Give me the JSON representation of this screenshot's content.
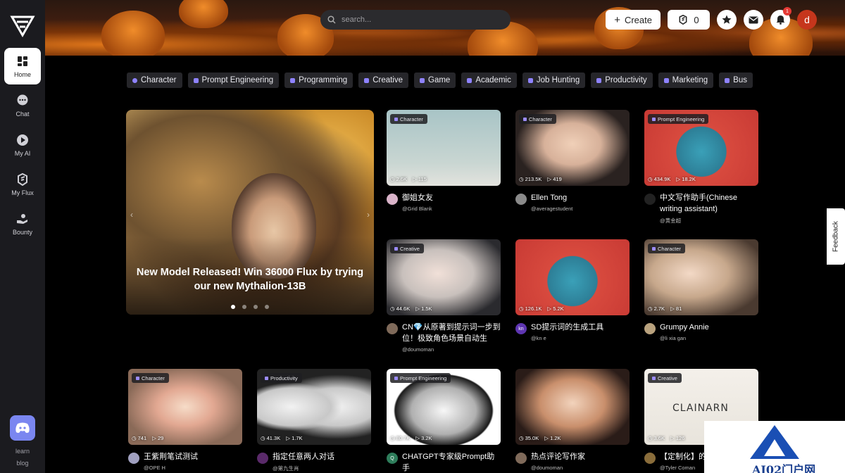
{
  "sidebar": {
    "items": [
      {
        "label": "Home",
        "icon": "grid-icon",
        "active": true
      },
      {
        "label": "Chat",
        "icon": "chat-bubble-icon"
      },
      {
        "label": "My AI",
        "icon": "play-circle-icon"
      },
      {
        "label": "My Flux",
        "icon": "flux-logo-icon"
      },
      {
        "label": "Bounty",
        "icon": "hand-coins-icon"
      }
    ],
    "learn_label": "learn",
    "blog_label": "blog"
  },
  "header": {
    "search_placeholder": "search...",
    "create_label": "Create",
    "flux_count": "0",
    "notification_count": "1",
    "avatar_letter": "d"
  },
  "categories": [
    "Character",
    "Prompt Engineering",
    "Programming",
    "Creative",
    "Game",
    "Academic",
    "Job Hunting",
    "Productivity",
    "Marketing",
    "Bus"
  ],
  "hero": {
    "title": "New Model Released! Win 36000 Flux by trying our new Mythalion-13B"
  },
  "cards": [
    {
      "tag": "Character",
      "views": "2.6K",
      "plays": "115",
      "title": "御姐女友",
      "author": "@Grid Blank",
      "avatar_color": "#d9b3c9",
      "avatar_text": ""
    },
    {
      "tag": "Character",
      "views": "213.5K",
      "plays": "419",
      "title": "Ellen Tong",
      "author": "@averagestudent",
      "avatar_color": "#8a8a8a",
      "avatar_text": ""
    },
    {
      "tag": "Prompt Engineering",
      "views": "434.9K",
      "plays": "18.2K",
      "title": "中文写作助手(Chinese writing assistant)",
      "author": "@黄金超",
      "avatar_color": "#222",
      "avatar_text": ""
    },
    {
      "tag": "Creative",
      "views": "44.6K",
      "plays": "1.5K",
      "title": "CN💎从原著到提示词一步到位！极致角色场景自动生成...",
      "author": "@doumoman",
      "avatar_color": "#7f6a5a",
      "avatar_text": ""
    },
    {
      "tag": "",
      "views": "126.1K",
      "plays": "5.2K",
      "title": "SD提示词的生成工具",
      "author": "@kn e",
      "avatar_color": "#5e35b1",
      "avatar_text": "kn"
    },
    {
      "tag": "Character",
      "views": "2.7K",
      "plays": "81",
      "title": "Grumpy Annie",
      "author": "@li xia gan",
      "avatar_color": "#b9a27e",
      "avatar_text": ""
    },
    {
      "tag": "Character",
      "views": "741",
      "plays": "29",
      "title": "王紫荆笔试测试",
      "author": "@OPE H",
      "avatar_color": "#a0a0c0",
      "avatar_text": ""
    },
    {
      "tag": "Productivity",
      "views": "41.3K",
      "plays": "1.7K",
      "title": "指定任意两人对话",
      "author": "@第九生肖",
      "avatar_color": "#5a2a6a",
      "avatar_text": ""
    },
    {
      "tag": "Prompt Engineering",
      "views": "80.7K",
      "plays": "3.2K",
      "title": "CHATGPT专家级Prompt助手",
      "author": "@9tigers2bull",
      "avatar_color": "#2e7d5b",
      "avatar_text": "Q"
    },
    {
      "tag": "",
      "views": "35.0K",
      "plays": "1.2K",
      "title": "热点评论写作家",
      "author": "@doumoman",
      "avatar_color": "#7f6a5a",
      "avatar_text": ""
    },
    {
      "tag": "Creative",
      "views": "3.6K",
      "plays": "126",
      "title": "【定制化】的",
      "author": "@Tyler Coman",
      "avatar_color": "#8a6d3b",
      "avatar_text": ""
    }
  ],
  "feedback_label": "Feedback",
  "watermark_text": "AI02门户网",
  "thumb_logo_text": "CLAINARN"
}
